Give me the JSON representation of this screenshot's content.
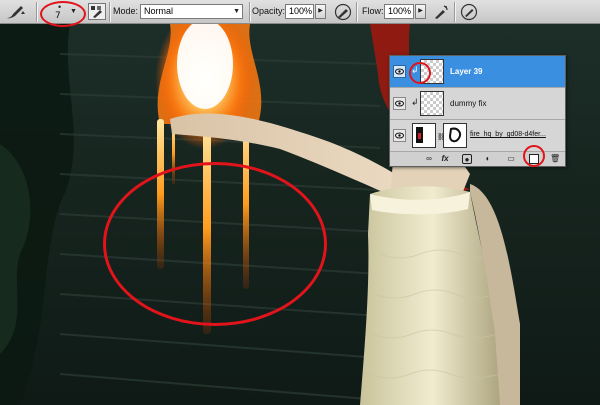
{
  "options_bar": {
    "brush_size": "7",
    "mode_label": "Mode:",
    "mode_value": "Normal",
    "opacity_label": "Opacity:",
    "opacity_value": "100%",
    "flow_label": "Flow:",
    "flow_value": "100%"
  },
  "layers_panel": {
    "layers": [
      {
        "name": "Layer 39",
        "selected": true,
        "visible": true
      },
      {
        "name": "dummy fix",
        "selected": false,
        "visible": true
      },
      {
        "name": "fire_hq_by_gd08-d4fer...",
        "selected": false,
        "visible": true
      }
    ],
    "footer_icons": [
      "link-icon",
      "fx-icon",
      "mask-icon",
      "adjustment-icon",
      "group-folder-icon",
      "new-layer-icon",
      "trash-icon"
    ]
  },
  "colors": {
    "annotation": "#e0141a",
    "selection": "#3b8fe0"
  }
}
